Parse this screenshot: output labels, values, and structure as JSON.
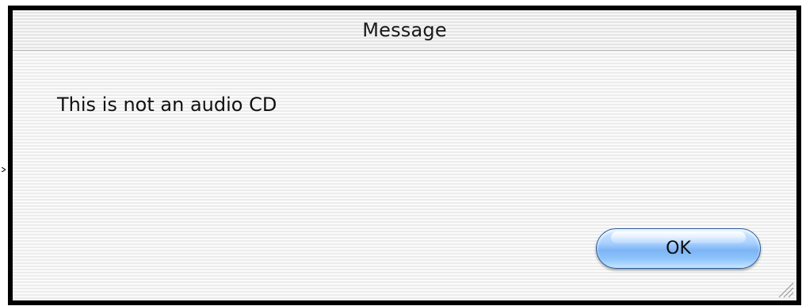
{
  "window": {
    "title": "Message"
  },
  "dialog": {
    "message": "This is not an audio CD",
    "ok_label": "OK"
  },
  "icons": {
    "resize_grip": "resize-grip-icon"
  },
  "colors": {
    "frame": "#000000",
    "button_blue": "#7db4f4",
    "button_border": "#2b5d9c"
  }
}
